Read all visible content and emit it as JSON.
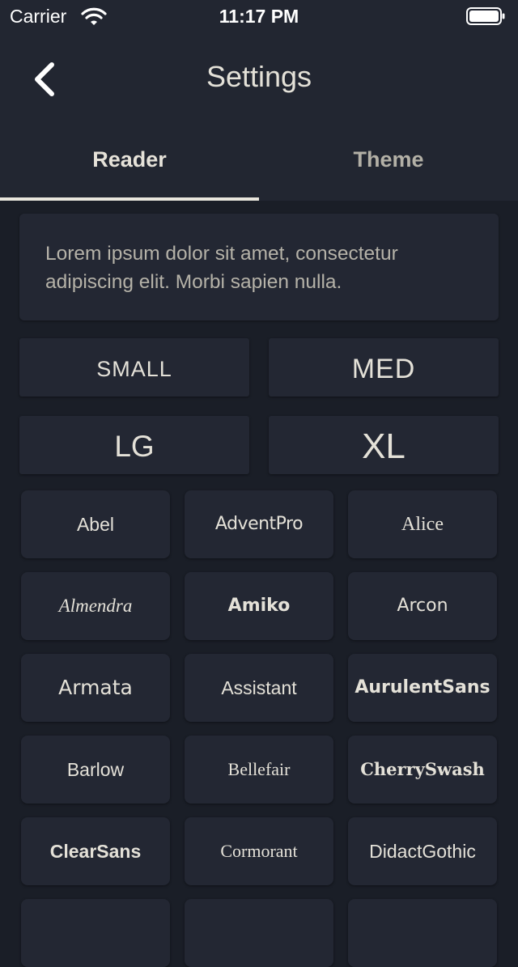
{
  "status": {
    "carrier": "Carrier",
    "time": "11:17 PM"
  },
  "nav": {
    "title": "Settings",
    "back_icon": "chevron-left-icon"
  },
  "tabs": [
    {
      "label": "Reader",
      "selected": true
    },
    {
      "label": "Theme",
      "selected": false
    }
  ],
  "preview": {
    "text": "Lorem ipsum dolor sit amet, consectetur adipiscing elit. Morbi sapien nulla."
  },
  "sizes": [
    {
      "label": "SMALL"
    },
    {
      "label": "MED"
    },
    {
      "label": "LG"
    },
    {
      "label": "XL"
    }
  ],
  "fonts": [
    {
      "label": "Abel"
    },
    {
      "label": "AdventPro"
    },
    {
      "label": "Alice"
    },
    {
      "label": "Almendra"
    },
    {
      "label": "Amiko"
    },
    {
      "label": "Arcon"
    },
    {
      "label": "Armata"
    },
    {
      "label": "Assistant"
    },
    {
      "label": "AurulentSans"
    },
    {
      "label": "Barlow"
    },
    {
      "label": "Bellefair"
    },
    {
      "label": "CherrySwash"
    },
    {
      "label": "ClearSans"
    },
    {
      "label": "Cormorant"
    },
    {
      "label": "DidactGothic"
    },
    {
      "label": ""
    },
    {
      "label": ""
    },
    {
      "label": ""
    }
  ],
  "colors": {
    "background": "#1a1e27",
    "surface": "#232733",
    "bar": "#222631",
    "text": "#e9e6dd"
  }
}
